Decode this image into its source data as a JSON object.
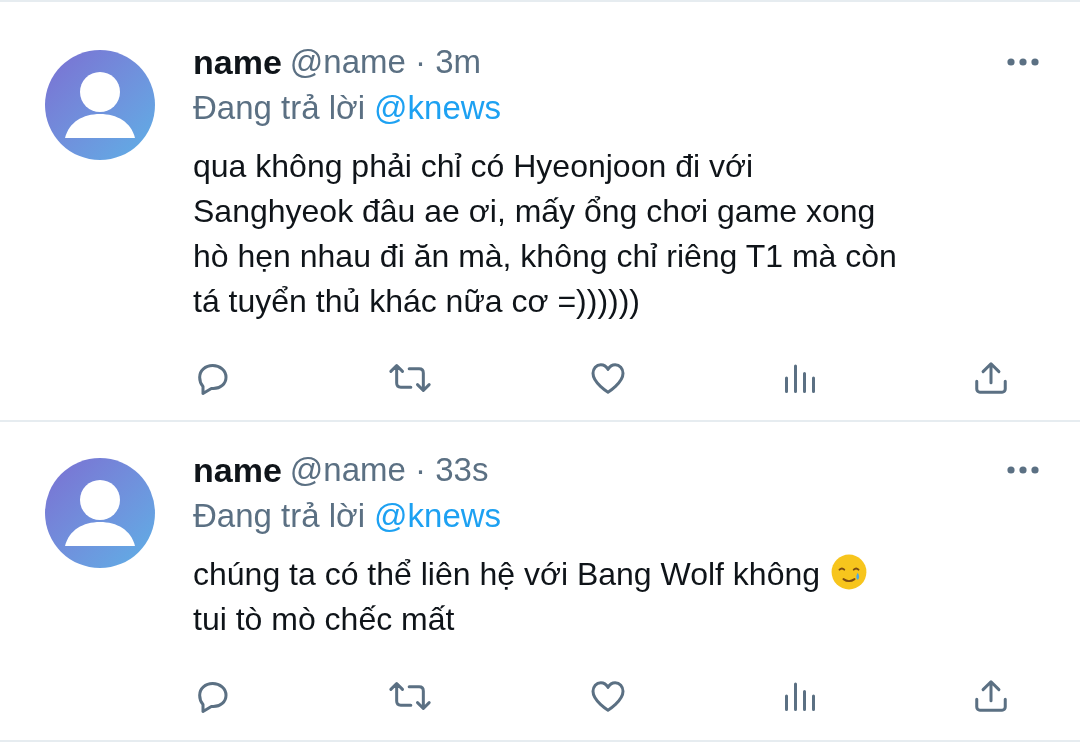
{
  "tweets": [
    {
      "name": "name",
      "meta": "@name · 3m",
      "reply_prefix": "Đang trả lời",
      "reply_to": "@knews",
      "lines": [
        [
          {
            "kind": "text",
            "text": "qua không phải chỉ có Hyeonjoon đi với"
          }
        ],
        [
          {
            "kind": "text",
            "text": "Sanghyeok đâu ae ơi, mấy ổng chơi game xong"
          }
        ],
        [
          {
            "kind": "text",
            "text": "hò hẹn nhau đi ăn mà, không chỉ riêng T1 mà còn"
          }
        ],
        [
          {
            "kind": "text",
            "text": "tá tuyển thủ khác nữa cơ =))))))"
          }
        ]
      ]
    },
    {
      "name": "name",
      "meta": "@name · 33s",
      "reply_prefix": "Đang trả lời",
      "reply_to": "@knews",
      "lines": [
        [
          {
            "kind": "text",
            "text": "chúng ta có thể liên hệ với Bang Wolf không"
          },
          {
            "kind": "emoji"
          }
        ],
        [
          {
            "kind": "text",
            "text": "tui tò mò chếc mất"
          }
        ]
      ]
    }
  ]
}
